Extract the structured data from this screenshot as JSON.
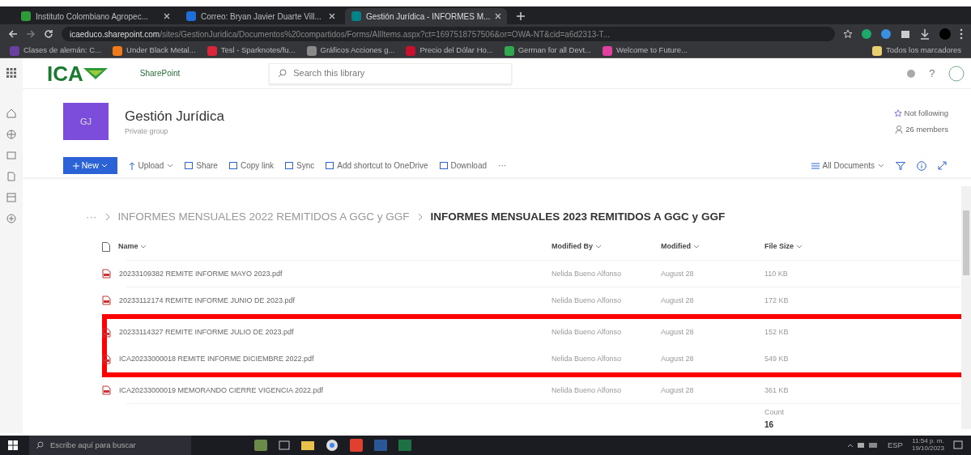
{
  "browser": {
    "tabs": [
      {
        "label": "Instituto Colombiano Agropec...",
        "selected": false
      },
      {
        "label": "Correo: Bryan Javier Duarte Vill...",
        "selected": false
      },
      {
        "label": "Gestión Jurídica - INFORMES M...",
        "selected": true
      }
    ],
    "url_host": "icaeduco.sharepoint.com",
    "url_path": "/sites/GestionJuridica/Documentos%20compartidos/Forms/AllItems.aspx?ct=1697518757506&or=OWA-NT&cid=a6d2313-T...",
    "bookmarks": [
      {
        "label": "Clases de alemán: C...",
        "color": "#6b3fa0"
      },
      {
        "label": "Under Black Metal...",
        "color": "#f07a1a"
      },
      {
        "label": "Tesl - Sparknotes/fu...",
        "color": "#d8263a"
      },
      {
        "label": "Gráficos Acciones g...",
        "color": "#8a8a8a"
      },
      {
        "label": "Precio del Dólar Ho...",
        "color": "#c8102e"
      },
      {
        "label": "German for all Devt...",
        "color": "#2fa84f"
      },
      {
        "label": "Welcome to Future...",
        "color": "#e040a0"
      }
    ],
    "other_bookmarks": "Todos los marcadores"
  },
  "suite": {
    "logo": "ICA",
    "app": "SharePoint",
    "search_placeholder": "Search this library",
    "help": "?"
  },
  "site": {
    "initials": "GJ",
    "title": "Gestión Jurídica",
    "subtitle": "Private group",
    "follow": "Not following",
    "members": "26 members"
  },
  "commands": [
    {
      "label": "New",
      "kind": "primary"
    },
    {
      "label": "Upload",
      "kind": "menu"
    },
    {
      "label": "Share",
      "kind": "action"
    },
    {
      "label": "Copy link",
      "kind": "action"
    },
    {
      "label": "Sync",
      "kind": "action"
    },
    {
      "label": "Add shortcut to OneDrive",
      "kind": "action"
    },
    {
      "label": "Download",
      "kind": "action"
    },
    {
      "label": "···",
      "kind": "more"
    }
  ],
  "view": "All Documents",
  "breadcrumb": [
    {
      "label": "···",
      "current": false
    },
    {
      "label": "INFORMES MENSUALES 2022 REMITIDOS A GGC y GGF",
      "current": false
    },
    {
      "label": "INFORMES MENSUALES 2023 REMITIDOS A GGC y GGF",
      "current": true
    }
  ],
  "table": {
    "columns": [
      "Name",
      "Modified By",
      "Modified",
      "File Size"
    ],
    "rows": [
      {
        "name": "20233109382 REMITE INFORME MAYO 2023.pdf",
        "modified_by": "Nelida Bueno Alfonso",
        "modified": "August 28",
        "size": "110 KB",
        "highlighted": false
      },
      {
        "name": "20233112174 REMITE INFORME JUNIO DE 2023.pdf",
        "modified_by": "Nelida Bueno Alfonso",
        "modified": "August 28",
        "size": "172 KB",
        "highlighted": false
      },
      {
        "name": "20233114327 REMITE INFORME JULIO DE 2023.pdf",
        "modified_by": "Nelida Bueno Alfonso",
        "modified": "August 28",
        "size": "152 KB",
        "highlighted": true
      },
      {
        "name": "ICA20233000018 REMITE INFORME DICIEMBRE 2022.pdf",
        "modified_by": "Nelida Bueno Alfonso",
        "modified": "August 28",
        "size": "549 KB",
        "highlighted": true
      },
      {
        "name": "ICA20233000019 MEMORANDO CIERRE VIGENCIA 2022.pdf",
        "modified_by": "Nelida Bueno Alfonso",
        "modified": "August 28",
        "size": "361 KB",
        "highlighted": false
      }
    ],
    "count_label": "Count",
    "count": "16"
  },
  "taskbar": {
    "search_placeholder": "Escribe aquí para buscar",
    "lang": "ESP",
    "time": "11:54 p. m.",
    "date": "19/10/2023"
  }
}
